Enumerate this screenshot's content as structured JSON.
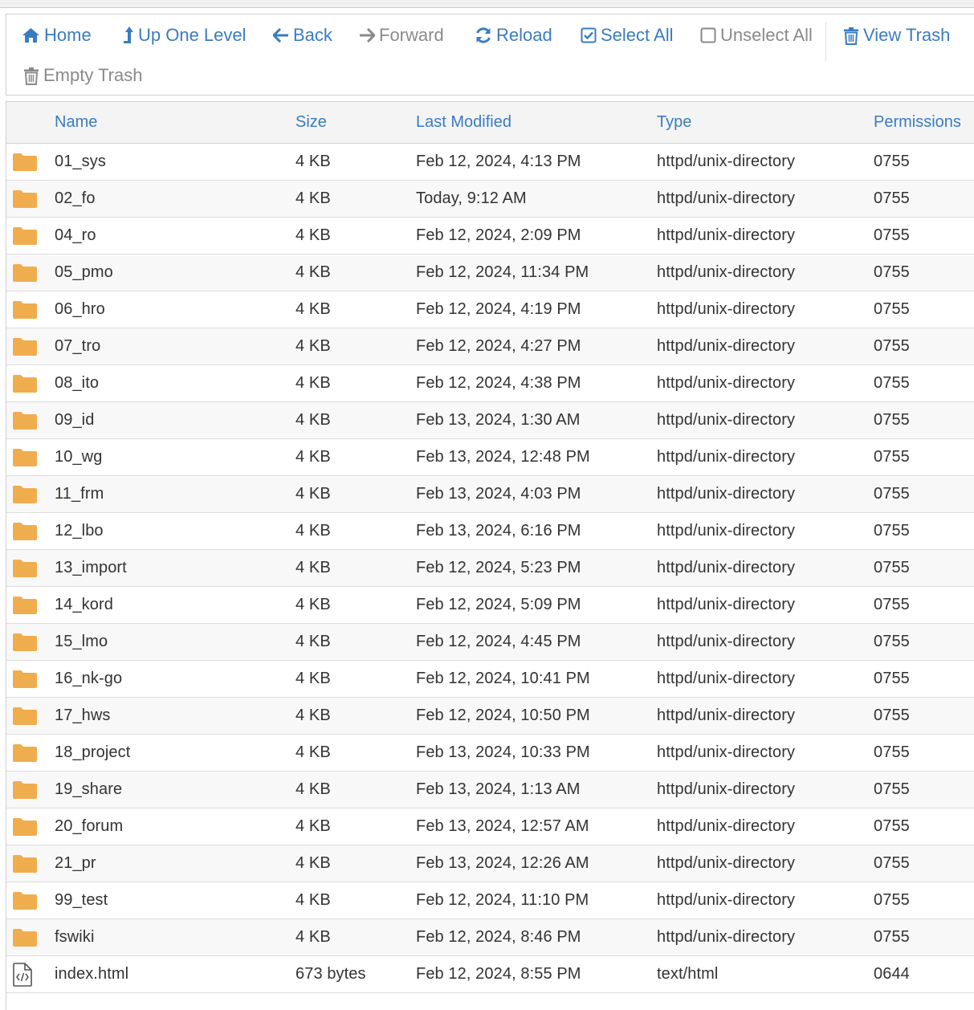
{
  "toolbar": {
    "home": "Home",
    "up_one_level": "Up One Level",
    "back": "Back",
    "forward": "Forward",
    "reload": "Reload",
    "select_all": "Select All",
    "unselect_all": "Unselect All",
    "view_trash": "View Trash",
    "empty_trash": "Empty Trash"
  },
  "columns": {
    "name": "Name",
    "size": "Size",
    "last_modified": "Last Modified",
    "type": "Type",
    "permissions": "Permissions"
  },
  "colors": {
    "accent": "#3a7cc1",
    "folder": "#f0ad4e",
    "disabled": "#8a8a8a"
  },
  "rows": [
    {
      "icon": "folder-icon",
      "name": "01_sys",
      "size": "4 KB",
      "modified": "Feb 12, 2024, 4:13 PM",
      "type": "httpd/unix-directory",
      "perms": "0755"
    },
    {
      "icon": "folder-icon",
      "name": "02_fo",
      "size": "4 KB",
      "modified": "Today, 9:12 AM",
      "type": "httpd/unix-directory",
      "perms": "0755"
    },
    {
      "icon": "folder-icon",
      "name": "04_ro",
      "size": "4 KB",
      "modified": "Feb 12, 2024, 2:09 PM",
      "type": "httpd/unix-directory",
      "perms": "0755"
    },
    {
      "icon": "folder-icon",
      "name": "05_pmo",
      "size": "4 KB",
      "modified": "Feb 12, 2024, 11:34 PM",
      "type": "httpd/unix-directory",
      "perms": "0755"
    },
    {
      "icon": "folder-icon",
      "name": "06_hro",
      "size": "4 KB",
      "modified": "Feb 12, 2024, 4:19 PM",
      "type": "httpd/unix-directory",
      "perms": "0755"
    },
    {
      "icon": "folder-icon",
      "name": "07_tro",
      "size": "4 KB",
      "modified": "Feb 12, 2024, 4:27 PM",
      "type": "httpd/unix-directory",
      "perms": "0755"
    },
    {
      "icon": "folder-icon",
      "name": "08_ito",
      "size": "4 KB",
      "modified": "Feb 12, 2024, 4:38 PM",
      "type": "httpd/unix-directory",
      "perms": "0755"
    },
    {
      "icon": "folder-icon",
      "name": "09_id",
      "size": "4 KB",
      "modified": "Feb 13, 2024, 1:30 AM",
      "type": "httpd/unix-directory",
      "perms": "0755"
    },
    {
      "icon": "folder-icon",
      "name": "10_wg",
      "size": "4 KB",
      "modified": "Feb 13, 2024, 12:48 PM",
      "type": "httpd/unix-directory",
      "perms": "0755"
    },
    {
      "icon": "folder-icon",
      "name": "11_frm",
      "size": "4 KB",
      "modified": "Feb 13, 2024, 4:03 PM",
      "type": "httpd/unix-directory",
      "perms": "0755"
    },
    {
      "icon": "folder-icon",
      "name": "12_lbo",
      "size": "4 KB",
      "modified": "Feb 13, 2024, 6:16 PM",
      "type": "httpd/unix-directory",
      "perms": "0755"
    },
    {
      "icon": "folder-icon",
      "name": "13_import",
      "size": "4 KB",
      "modified": "Feb 12, 2024, 5:23 PM",
      "type": "httpd/unix-directory",
      "perms": "0755"
    },
    {
      "icon": "folder-icon",
      "name": "14_kord",
      "size": "4 KB",
      "modified": "Feb 12, 2024, 5:09 PM",
      "type": "httpd/unix-directory",
      "perms": "0755"
    },
    {
      "icon": "folder-icon",
      "name": "15_lmo",
      "size": "4 KB",
      "modified": "Feb 12, 2024, 4:45 PM",
      "type": "httpd/unix-directory",
      "perms": "0755"
    },
    {
      "icon": "folder-icon",
      "name": "16_nk-go",
      "size": "4 KB",
      "modified": "Feb 12, 2024, 10:41 PM",
      "type": "httpd/unix-directory",
      "perms": "0755"
    },
    {
      "icon": "folder-icon",
      "name": "17_hws",
      "size": "4 KB",
      "modified": "Feb 12, 2024, 10:50 PM",
      "type": "httpd/unix-directory",
      "perms": "0755"
    },
    {
      "icon": "folder-icon",
      "name": "18_project",
      "size": "4 KB",
      "modified": "Feb 13, 2024, 10:33 PM",
      "type": "httpd/unix-directory",
      "perms": "0755"
    },
    {
      "icon": "folder-icon",
      "name": "19_share",
      "size": "4 KB",
      "modified": "Feb 13, 2024, 1:13 AM",
      "type": "httpd/unix-directory",
      "perms": "0755"
    },
    {
      "icon": "folder-icon",
      "name": "20_forum",
      "size": "4 KB",
      "modified": "Feb 13, 2024, 12:57 AM",
      "type": "httpd/unix-directory",
      "perms": "0755"
    },
    {
      "icon": "folder-icon",
      "name": "21_pr",
      "size": "4 KB",
      "modified": "Feb 13, 2024, 12:26 AM",
      "type": "httpd/unix-directory",
      "perms": "0755"
    },
    {
      "icon": "folder-icon",
      "name": "99_test",
      "size": "4 KB",
      "modified": "Feb 12, 2024, 11:10 PM",
      "type": "httpd/unix-directory",
      "perms": "0755"
    },
    {
      "icon": "folder-icon",
      "name": "fswiki",
      "size": "4 KB",
      "modified": "Feb 12, 2024, 8:46 PM",
      "type": "httpd/unix-directory",
      "perms": "0755"
    },
    {
      "icon": "html-file-icon",
      "name": "index.html",
      "size": "673 bytes",
      "modified": "Feb 12, 2024, 8:55 PM",
      "type": "text/html",
      "perms": "0644"
    }
  ]
}
